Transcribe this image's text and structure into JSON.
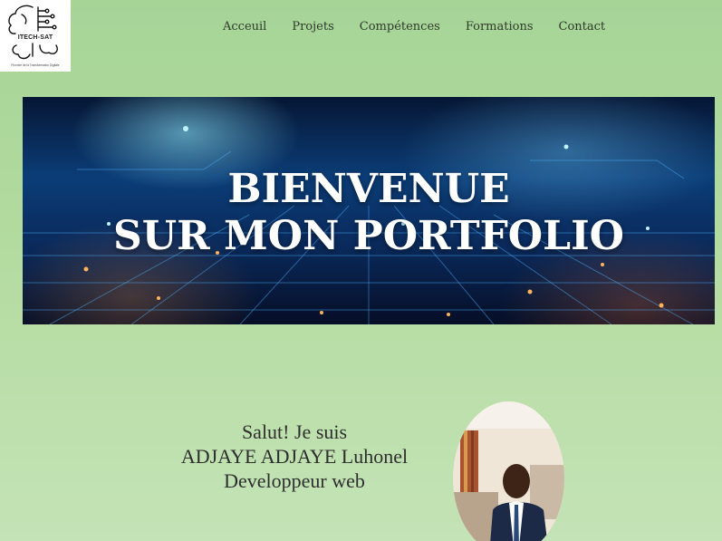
{
  "logo": {
    "brand": "ITECH-SAT",
    "tagline": "Pionnier de la Transformation Digitale"
  },
  "nav": {
    "items": [
      "Acceuil",
      "Projets",
      "Compétences",
      "Formations",
      "Contact"
    ]
  },
  "hero": {
    "line1": "BIENVENUE",
    "line2": "SUR MON PORTFOLIO"
  },
  "intro": {
    "greeting": "Salut! Je suis",
    "name": "ADJAYE ADJAYE Luhonel",
    "role": "Developpeur web"
  }
}
